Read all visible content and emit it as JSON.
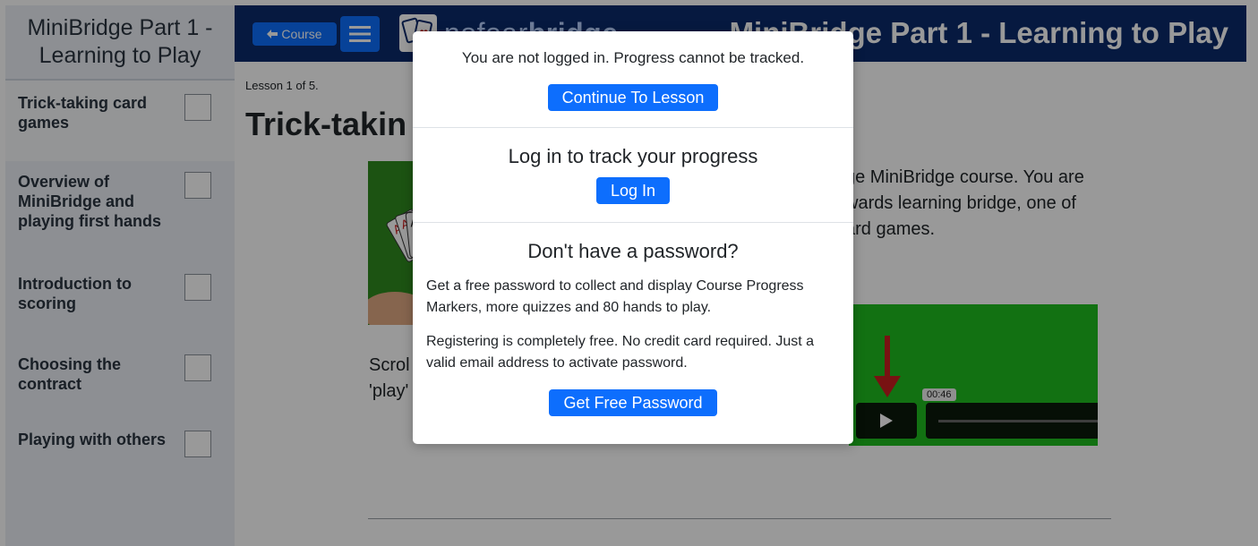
{
  "sidebar": {
    "title": "MiniBridge Part 1 - Learning to Play",
    "lessons": [
      {
        "label": "Trick-taking card games"
      },
      {
        "label": "Overview of MiniBridge and playing first hands"
      },
      {
        "label": "Introduction to scoring"
      },
      {
        "label": "Choosing the contract"
      },
      {
        "label": "Playing with others"
      }
    ]
  },
  "header": {
    "course_label": "Course",
    "logo_plain": "nofear",
    "logo_bold": "bridge",
    "title": "MiniBridge Part 1 - Learning to Play"
  },
  "main": {
    "lesson_count": "Lesson 1 of 5.",
    "title": "Trick-takin",
    "intro_text": "ge MiniBridge course.  You are\nwards learning bridge, one of\nard games.",
    "scroll_text": "Scrol\n'play'",
    "video_time": "00:46"
  },
  "modal": {
    "not_logged_in": "You are not logged in. Progress cannot be tracked.",
    "continue_button": "Continue To Lesson",
    "login_heading": "Log in to track your progress",
    "login_button": "Log In",
    "password_heading": "Don't have a password?",
    "password_text": "Get a free password to collect and display Course Progress Markers, more quizzes and 80 hands to play.",
    "register_text": "Registering is completely free. No credit card required. Just a valid email address to activate password.",
    "password_button": "Get Free Password"
  },
  "colors": {
    "header_bg": "#0a2a6c",
    "accent": "#0d6efd",
    "sidebar_bg": "#ebeff5",
    "video_bg": "#1fbd1f",
    "arrow": "#c81e1e"
  }
}
